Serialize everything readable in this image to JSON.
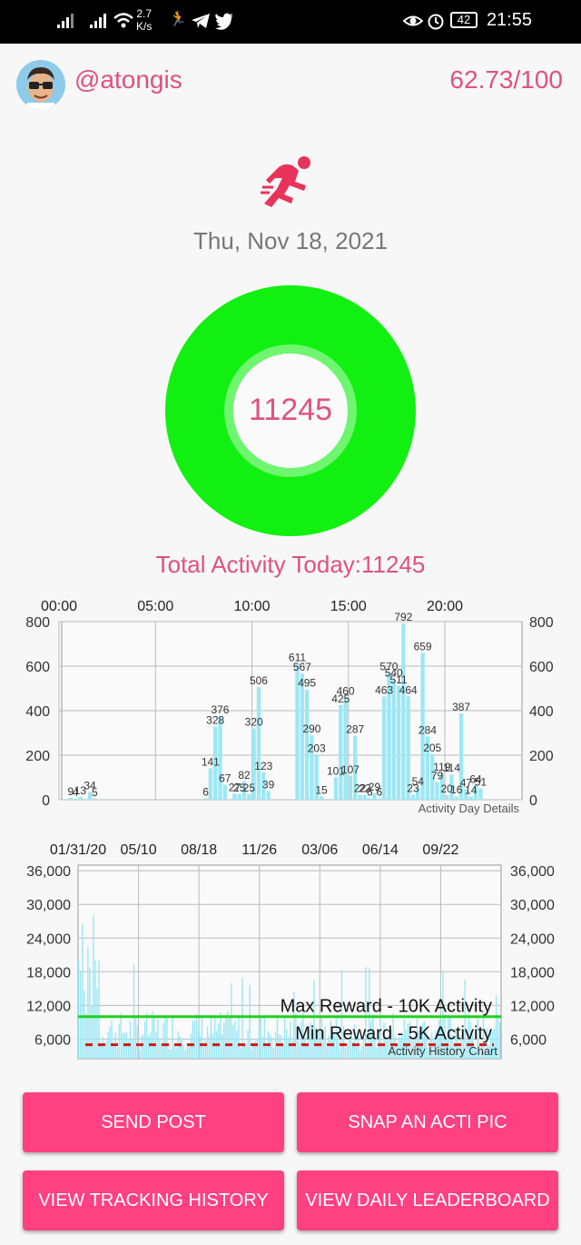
{
  "status_bar": {
    "net_speed_value": "2.7",
    "net_speed_unit": "K/s",
    "battery": "42",
    "time": "21:55"
  },
  "header": {
    "username": "@atongis",
    "score": "62.73/100"
  },
  "activity": {
    "date": "Thu, Nov 18, 2021",
    "ring_value": "11245",
    "total_label": "Total Activity Today:11245",
    "ring_color": "#11f011"
  },
  "chart_data": [
    {
      "type": "bar",
      "label": "Activity Day Details",
      "x_ticks": [
        "00:00",
        "05:00",
        "10:00",
        "15:00",
        "20:00"
      ],
      "y_ticks": [
        "0",
        "200",
        "400",
        "600",
        "800"
      ],
      "ylim": [
        0,
        800
      ],
      "bars": [
        {
          "h": 0.5,
          "v": 9
        },
        {
          "h": 0.75,
          "v": 4
        },
        {
          "h": 1.0,
          "v": 13
        },
        {
          "h": 1.5,
          "v": 34
        },
        {
          "h": 1.75,
          "v": 5
        },
        {
          "h": 7.5,
          "v": 6
        },
        {
          "h": 7.75,
          "v": 141
        },
        {
          "h": 8.0,
          "v": 328
        },
        {
          "h": 8.25,
          "v": 376
        },
        {
          "h": 8.5,
          "v": 67
        },
        {
          "h": 9.0,
          "v": 27
        },
        {
          "h": 9.25,
          "v": 25
        },
        {
          "h": 9.5,
          "v": 82
        },
        {
          "h": 9.75,
          "v": 25
        },
        {
          "h": 10.0,
          "v": 320
        },
        {
          "h": 10.25,
          "v": 506
        },
        {
          "h": 10.5,
          "v": 123
        },
        {
          "h": 10.75,
          "v": 39
        },
        {
          "h": 12.25,
          "v": 611
        },
        {
          "h": 12.5,
          "v": 567
        },
        {
          "h": 12.75,
          "v": 495
        },
        {
          "h": 13.0,
          "v": 290
        },
        {
          "h": 13.25,
          "v": 203
        },
        {
          "h": 13.5,
          "v": 15
        },
        {
          "h": 14.25,
          "v": 101
        },
        {
          "h": 14.5,
          "v": 425
        },
        {
          "h": 14.75,
          "v": 460
        },
        {
          "h": 15.0,
          "v": 107
        },
        {
          "h": 15.25,
          "v": 287
        },
        {
          "h": 15.5,
          "v": 22
        },
        {
          "h": 15.75,
          "v": 22
        },
        {
          "h": 16.0,
          "v": 6
        },
        {
          "h": 16.25,
          "v": 29
        },
        {
          "h": 16.5,
          "v": 6
        },
        {
          "h": 16.75,
          "v": 463
        },
        {
          "h": 17.0,
          "v": 570
        },
        {
          "h": 17.25,
          "v": 540
        },
        {
          "h": 17.5,
          "v": 511
        },
        {
          "h": 17.75,
          "v": 792
        },
        {
          "h": 18.0,
          "v": 464
        },
        {
          "h": 18.25,
          "v": 23
        },
        {
          "h": 18.5,
          "v": 54
        },
        {
          "h": 18.75,
          "v": 659
        },
        {
          "h": 19.0,
          "v": 284
        },
        {
          "h": 19.25,
          "v": 205
        },
        {
          "h": 19.5,
          "v": 79
        },
        {
          "h": 19.75,
          "v": 119
        },
        {
          "h": 20.0,
          "v": 20
        },
        {
          "h": 20.25,
          "v": 114
        },
        {
          "h": 20.5,
          "v": 16
        },
        {
          "h": 20.75,
          "v": 387
        },
        {
          "h": 21.0,
          "v": 47
        },
        {
          "h": 21.25,
          "v": 14
        },
        {
          "h": 21.5,
          "v": 64
        },
        {
          "h": 21.75,
          "v": 51
        }
      ]
    },
    {
      "type": "bar",
      "label": "Activity History Chart",
      "x_ticks": [
        "01/31/20",
        "05/10",
        "08/18",
        "11/26",
        "03/06",
        "06/14",
        "09/22"
      ],
      "y_ticks": [
        "6,000",
        "12,000",
        "18,000",
        "24,000",
        "30,000",
        "36,000"
      ],
      "ylim": [
        2500,
        37000
      ],
      "max_line": {
        "label": "Max Reward - 10K Activity",
        "value": 10000,
        "color": "#1fd11f"
      },
      "min_line": {
        "label": "Min Reward - 5K Activity",
        "value": 5000,
        "color": "#d0171b"
      }
    }
  ],
  "buttons": {
    "send_post": "SEND POST",
    "snap": "SNAP AN ACTI PIC",
    "history": "VIEW TRACKING HISTORY",
    "leaderboard": "VIEW DAILY LEADERBOARD"
  },
  "colors": {
    "accent": "#e05080",
    "button": "#ff4081",
    "bar": "#9be8f5"
  }
}
